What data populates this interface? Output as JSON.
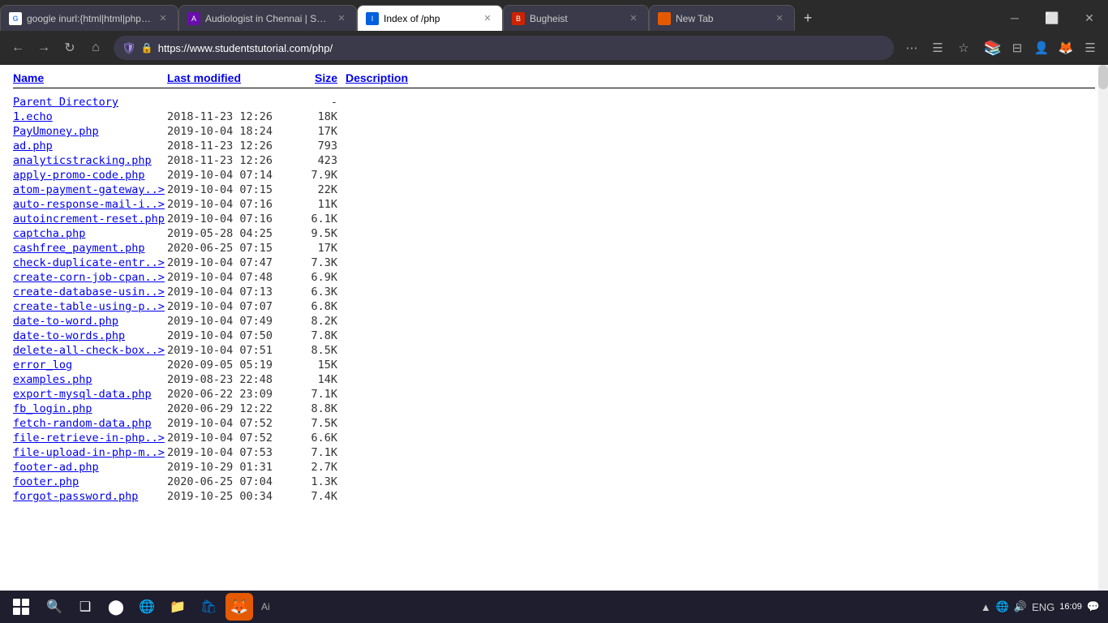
{
  "browser": {
    "tabs": [
      {
        "id": "tab-google",
        "title": "google inurl:{html|html|php|pl>",
        "active": false,
        "favicon": "G"
      },
      {
        "id": "tab-audiologist",
        "title": "Audiologist in Chennai | Speec",
        "active": false,
        "favicon": "A"
      },
      {
        "id": "tab-index",
        "title": "Index of /php",
        "active": true,
        "favicon": "I"
      },
      {
        "id": "tab-bugheist",
        "title": "Bugheist",
        "active": false,
        "favicon": "B"
      },
      {
        "id": "tab-newtab",
        "title": "New Tab",
        "active": false,
        "favicon": "N"
      }
    ],
    "url": "https://www.studentstutorial.com/php/",
    "nav": {
      "back": true,
      "forward": true,
      "refresh": true,
      "home": true
    }
  },
  "page": {
    "columns": {
      "name": "Name",
      "modified": "Last modified",
      "size": "Size",
      "description": "Description"
    },
    "parent": {
      "name": "Parent Directory",
      "size": "-"
    },
    "files": [
      {
        "name": "1.echo",
        "modified": "2018-11-23 12:26",
        "size": "18K"
      },
      {
        "name": "PayUmoney.php",
        "modified": "2019-10-04 18:24",
        "size": "17K"
      },
      {
        "name": "ad.php",
        "modified": "2018-11-23 12:26",
        "size": "793"
      },
      {
        "name": "analyticstracking.php",
        "modified": "2018-11-23 12:26",
        "size": "423"
      },
      {
        "name": "apply-promo-code.php",
        "modified": "2019-10-04 07:14",
        "size": "7.9K"
      },
      {
        "name": "atom-payment-gateway..>",
        "modified": "2019-10-04 07:15",
        "size": "22K"
      },
      {
        "name": "auto-response-mail-i..>",
        "modified": "2019-10-04 07:16",
        "size": "11K"
      },
      {
        "name": "autoincrement-reset.php",
        "modified": "2019-10-04 07:16",
        "size": "6.1K"
      },
      {
        "name": "captcha.php",
        "modified": "2019-05-28 04:25",
        "size": "9.5K"
      },
      {
        "name": "cashfree_payment.php",
        "modified": "2020-06-25 07:15",
        "size": "17K"
      },
      {
        "name": "check-duplicate-entr..>",
        "modified": "2019-10-04 07:47",
        "size": "7.3K"
      },
      {
        "name": "create-corn-job-cpan..>",
        "modified": "2019-10-04 07:48",
        "size": "6.9K"
      },
      {
        "name": "create-database-usin..>",
        "modified": "2019-10-04 07:13",
        "size": "6.3K"
      },
      {
        "name": "create-table-using-p..>",
        "modified": "2019-10-04 07:07",
        "size": "6.8K"
      },
      {
        "name": "date-to-word.php",
        "modified": "2019-10-04 07:49",
        "size": "8.2K"
      },
      {
        "name": "date-to-words.php",
        "modified": "2019-10-04 07:50",
        "size": "7.8K"
      },
      {
        "name": "delete-all-check-box..>",
        "modified": "2019-10-04 07:51",
        "size": "8.5K"
      },
      {
        "name": "error_log",
        "modified": "2020-09-05 05:19",
        "size": "15K"
      },
      {
        "name": "examples.php",
        "modified": "2019-08-23 22:48",
        "size": "14K"
      },
      {
        "name": "export-mysql-data.php",
        "modified": "2020-06-22 23:09",
        "size": "7.1K"
      },
      {
        "name": "fb_login.php",
        "modified": "2020-06-29 12:22",
        "size": "8.8K"
      },
      {
        "name": "fetch-random-data.php",
        "modified": "2019-10-04 07:52",
        "size": "7.5K"
      },
      {
        "name": "file-retrieve-in-php..>",
        "modified": "2019-10-04 07:52",
        "size": "6.6K"
      },
      {
        "name": "file-upload-in-php-m..>",
        "modified": "2019-10-04 07:53",
        "size": "7.1K"
      },
      {
        "name": "footer-ad.php",
        "modified": "2019-10-29 01:31",
        "size": "2.7K"
      },
      {
        "name": "footer.php",
        "modified": "2020-06-25 07:04",
        "size": "1.3K"
      },
      {
        "name": "forgot-password.php",
        "modified": "2019-10-25 00:34",
        "size": "7.4K"
      }
    ]
  },
  "taskbar": {
    "ai_label": "Ai",
    "time": "16:09",
    "lang": "ENG",
    "sys_icons": [
      "▲",
      "🔊",
      "🌐"
    ],
    "apps": [
      "⊞",
      "🔍",
      "❑",
      "≡",
      "📁",
      "🛡"
    ]
  }
}
